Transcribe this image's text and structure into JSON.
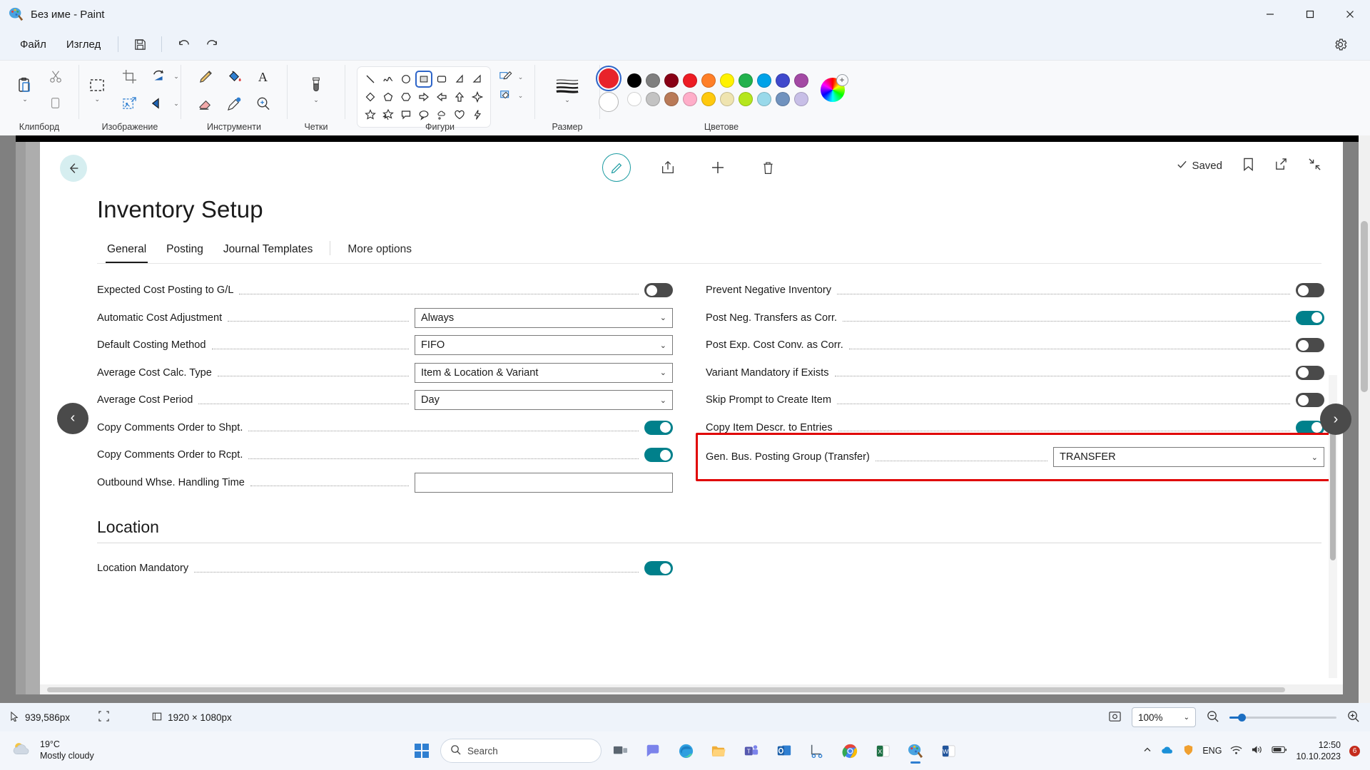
{
  "window": {
    "title": "Без име - Paint",
    "app_icon": "paint-icon",
    "minimize": "—",
    "maximize": "▢",
    "close": "✕"
  },
  "menu": {
    "items": [
      {
        "label": "Файл"
      },
      {
        "label": "Изглед"
      }
    ],
    "quick": [
      {
        "name": "save-icon",
        "glyph": "save"
      },
      {
        "name": "undo-icon",
        "glyph": "undo"
      },
      {
        "name": "redo-icon",
        "glyph": "redo"
      }
    ],
    "settings_icon": "gear-icon"
  },
  "ribbon": {
    "groups": [
      {
        "label": "Клипборд",
        "buttons": [
          {
            "name": "paste-button",
            "icon": "clipboard-icon",
            "has_chevron": true
          },
          {
            "name": "cut-button",
            "icon": "scissors-icon"
          },
          {
            "name": "copy-button",
            "icon": "copy-icon"
          }
        ]
      },
      {
        "label": "Изображение",
        "buttons": [
          {
            "name": "select-button",
            "icon": "selection-dashed-icon",
            "has_chevron": true
          },
          {
            "name": "crop-button",
            "icon": "crop-icon"
          },
          {
            "name": "resize-button",
            "icon": "resize-image-icon"
          },
          {
            "name": "rotate-button",
            "icon": "rotate-icon",
            "has_chevron": true
          },
          {
            "name": "flip-button",
            "icon": "flip-icon",
            "has_chevron": true
          }
        ]
      },
      {
        "label": "Инструменти",
        "buttons": [
          {
            "name": "pencil-button",
            "icon": "pencil-icon"
          },
          {
            "name": "fill-button",
            "icon": "paint-bucket-icon"
          },
          {
            "name": "text-button",
            "icon": "text-a-icon"
          },
          {
            "name": "eraser-button",
            "icon": "eraser-icon"
          },
          {
            "name": "color-picker-button",
            "icon": "eyedropper-icon"
          },
          {
            "name": "magnifier-button",
            "icon": "magnifier-icon"
          }
        ]
      },
      {
        "label": "Четки",
        "buttons": [
          {
            "name": "brushes-button",
            "icon": "brush-icon",
            "has_chevron": true
          }
        ]
      },
      {
        "label": "Фигури",
        "shapes_row1": [
          "line",
          "curve",
          "oval",
          "rectangle",
          "rounded-rectangle",
          "right-triangle"
        ],
        "shapes_row2": [
          "diamond",
          "pentagon",
          "hexagon",
          "arrow-right",
          "arrow-left",
          "arrow-up",
          "four-point-star"
        ],
        "shapes_row3": [
          "star-5",
          "star-6",
          "callout-rect",
          "callout-oval",
          "callout-cloud",
          "heart",
          "lightning"
        ],
        "selected_shape": "rectangle",
        "outline_button": "shape-outline-icon",
        "fill_button": "shape-fill-icon"
      },
      {
        "label": "Размер",
        "buttons": [
          {
            "name": "brush-size-button",
            "icon": "size-lines-icon",
            "has_chevron": true
          }
        ]
      },
      {
        "label": "Цветове",
        "primary_color": "#e8232a",
        "secondary_color": "#ffffff",
        "swatches_row1": [
          "#000000",
          "#7f7f7f",
          "#880015",
          "#ed1c24",
          "#ff7f27",
          "#fff200",
          "#22b14c",
          "#00a2e8",
          "#3f48cc",
          "#a349a4"
        ],
        "swatches_row2": [
          "#ffffff",
          "#c3c3c3",
          "#b97a57",
          "#ffaec9",
          "#ffc90e",
          "#efe4b0",
          "#b5e61d",
          "#99d9ea",
          "#7092be",
          "#c8bfe7"
        ],
        "color_wheel": "color-wheel-icon"
      }
    ]
  },
  "bc": {
    "back_icon": "back-arrow-icon",
    "toolbar": [
      {
        "name": "edit-button",
        "icon": "pencil-edit-icon"
      },
      {
        "name": "share-button",
        "icon": "share-icon"
      },
      {
        "name": "new-button",
        "icon": "plus-icon"
      },
      {
        "name": "delete-button",
        "icon": "trash-icon"
      }
    ],
    "saved_label": "Saved",
    "saved_icon": "check-icon",
    "bookmark_icon": "bookmark-icon",
    "open-new-window_icon": "open-in-new-window-icon",
    "minimize_icon": "collapse-icon",
    "page_title": "Inventory Setup",
    "tabs": [
      {
        "label": "General",
        "active": true
      },
      {
        "label": "Posting",
        "active": false
      },
      {
        "label": "Journal Templates",
        "active": false
      }
    ],
    "more_options": "More options",
    "left_fields": [
      {
        "label": "Expected Cost Posting to G/L",
        "type": "toggle",
        "value": "off"
      },
      {
        "label": "Automatic Cost Adjustment",
        "type": "select",
        "value": "Always"
      },
      {
        "label": "Default Costing Method",
        "type": "select",
        "value": "FIFO"
      },
      {
        "label": "Average Cost Calc. Type",
        "type": "select",
        "value": "Item & Location & Variant"
      },
      {
        "label": "Average Cost Period",
        "type": "select",
        "value": "Day"
      },
      {
        "label": "Copy Comments Order to Shpt.",
        "type": "toggle",
        "value": "on"
      },
      {
        "label": "Copy Comments Order to Rcpt.",
        "type": "toggle",
        "value": "on"
      },
      {
        "label": "Outbound Whse. Handling Time",
        "type": "text",
        "value": ""
      }
    ],
    "right_fields": [
      {
        "label": "Prevent Negative Inventory",
        "type": "toggle",
        "value": "off"
      },
      {
        "label": "Post Neg. Transfers as Corr.",
        "type": "toggle",
        "value": "on"
      },
      {
        "label": "Post Exp. Cost Conv. as Corr.",
        "type": "toggle",
        "value": "off"
      },
      {
        "label": "Variant Mandatory if Exists",
        "type": "toggle",
        "value": "off"
      },
      {
        "label": "Skip Prompt to Create Item",
        "type": "toggle",
        "value": "off"
      },
      {
        "label": "Copy Item Descr. to Entries",
        "type": "toggle",
        "value": "on"
      },
      {
        "label": "Gen. Bus. Posting Group (Transfer)",
        "type": "select",
        "value": "TRANSFER",
        "highlighted": true
      }
    ],
    "section_location": "Location",
    "location_fields": [
      {
        "label": "Location Mandatory",
        "type": "toggle",
        "value": "on"
      }
    ],
    "nav_prev": "‹",
    "nav_next": "›",
    "highlight_color": "#e00000"
  },
  "statusbar": {
    "cursor_icon": "cursor-icon",
    "cursor_pos": "939,586px",
    "selection_icon": "selection-size-icon",
    "canvas_icon": "canvas-size-icon",
    "canvas_size": "1920 × 1080px",
    "fit_icon": "fit-to-window-icon",
    "zoom_value": "100%",
    "zoom_out_icon": "zoom-out-icon",
    "zoom_in_icon": "zoom-in-icon"
  },
  "taskbar": {
    "weather_temp": "19°C",
    "weather_desc": "Mostly cloudy",
    "weather_icon": "cloud-icon",
    "start_icon": "windows-start-icon",
    "search_placeholder": "Search",
    "search_icon": "search-icon",
    "apps": [
      {
        "name": "task-view-icon",
        "label": "Task View"
      },
      {
        "name": "chat-icon",
        "label": "Chat"
      },
      {
        "name": "edge-icon",
        "label": "Microsoft Edge"
      },
      {
        "name": "file-explorer-icon",
        "label": "File Explorer"
      },
      {
        "name": "teams-icon",
        "label": "Microsoft Teams"
      },
      {
        "name": "outlook-icon",
        "label": "Outlook"
      },
      {
        "name": "snipping-tool-icon",
        "label": "Snipping Tool"
      },
      {
        "name": "chrome-icon",
        "label": "Google Chrome"
      },
      {
        "name": "excel-icon",
        "label": "Excel"
      },
      {
        "name": "paint-taskbar-icon",
        "label": "Paint",
        "active": true
      },
      {
        "name": "word-icon",
        "label": "Word"
      }
    ],
    "tray": {
      "chevron_icon": "show-hidden-icons-icon",
      "onedrive_icon": "onedrive-icon",
      "defender_icon": "defender-icon",
      "language": "ENG",
      "wifi_icon": "wifi-icon",
      "volume_icon": "volume-icon",
      "battery_icon": "battery-icon",
      "time": "12:50",
      "date": "10.10.2023",
      "notification_count": "6"
    }
  }
}
